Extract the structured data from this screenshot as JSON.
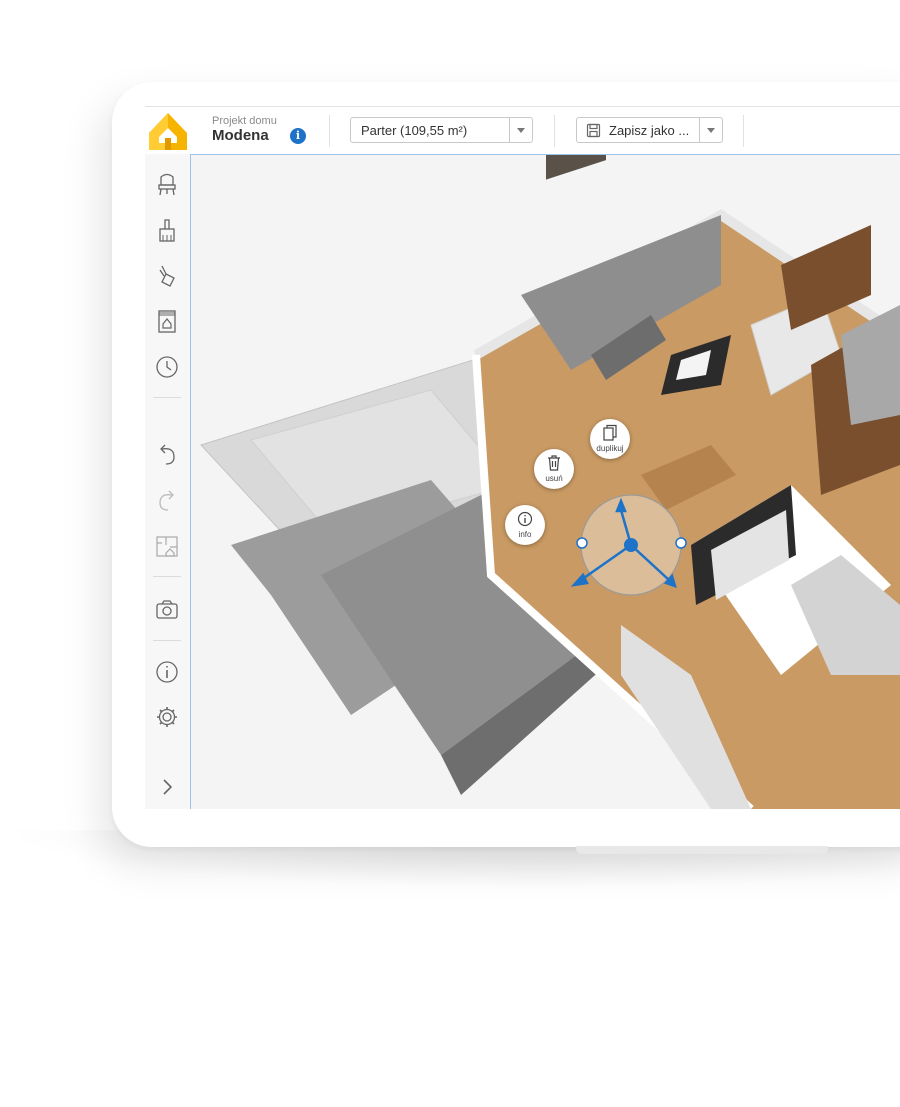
{
  "header": {
    "project_label": "Projekt domu",
    "project_name": "Modena",
    "info_badge": "i",
    "floor_select": {
      "value": "Parter (109,55 m²)"
    },
    "save_select": {
      "value": "Zapisz jako ..."
    }
  },
  "sidebar": {
    "items": [
      {
        "icon": "furniture-icon"
      },
      {
        "icon": "paint-brush-icon"
      },
      {
        "icon": "paint-bucket-icon"
      },
      {
        "icon": "catalog-icon"
      },
      {
        "icon": "history-clock-icon"
      },
      {
        "icon": "undo-icon"
      },
      {
        "icon": "redo-icon"
      },
      {
        "icon": "floor-plan-icon"
      },
      {
        "icon": "camera-icon"
      },
      {
        "icon": "info-icon"
      },
      {
        "icon": "settings-gear-icon"
      },
      {
        "icon": "expand-chevron-icon"
      }
    ]
  },
  "gizmo": {
    "delete_label": "usuń",
    "duplicate_label": "duplikuj",
    "info_label": "info"
  },
  "colors": {
    "accent_blue": "#1e73c8",
    "logo_yellow": "#f6b400",
    "wood": "#c99a63"
  }
}
